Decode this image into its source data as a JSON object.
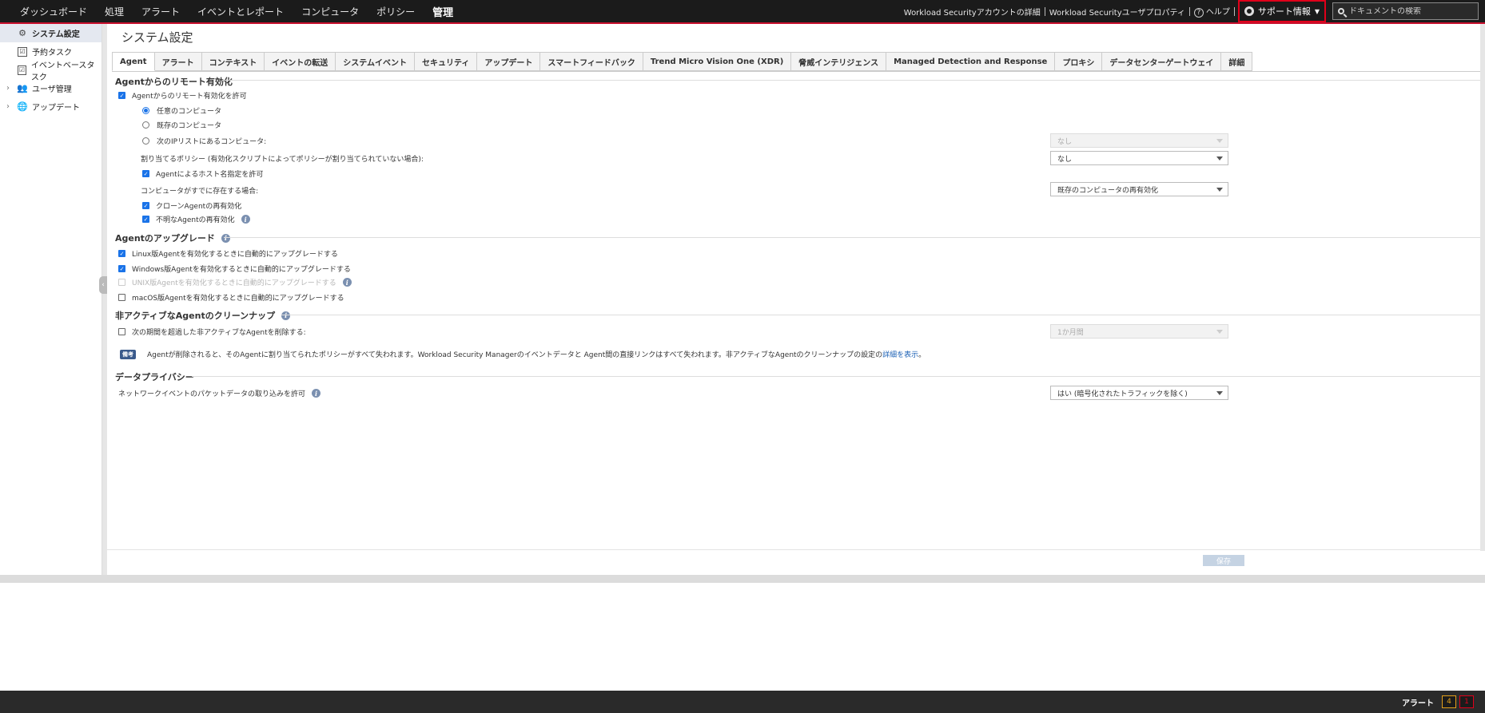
{
  "topnav": {
    "items": [
      "ダッシュボード",
      "処理",
      "アラート",
      "イベントとレポート",
      "コンピュータ",
      "ポリシー",
      "管理"
    ],
    "links": [
      "Workload Securityアカウントの詳細",
      "Workload Securityユーザプロパティ",
      "ヘルプ"
    ],
    "support_label": "サポート情報",
    "search_placeholder": "ドキュメントの検索"
  },
  "sidebar": {
    "items": [
      {
        "label": "システム設定"
      },
      {
        "label": "予約タスク"
      },
      {
        "label": "イベントベースタスク"
      },
      {
        "label": "ユーザ管理"
      },
      {
        "label": "アップデート"
      }
    ]
  },
  "main": {
    "title": "システム設定",
    "tabs": [
      "Agent",
      "アラート",
      "コンテキスト",
      "イベントの転送",
      "システムイベント",
      "セキュリティ",
      "アップデート",
      "スマートフィードバック",
      "Trend Micro Vision One (XDR)",
      "脅威インテリジェンス",
      "Managed Detection and Response",
      "プロキシ",
      "データセンターゲートウェイ",
      "詳細"
    ],
    "remote": {
      "heading": "Agentからのリモート有効化",
      "allow": "Agentからのリモート有効化を許可",
      "opt_any": "任意のコンピュータ",
      "opt_existing": "既存のコンピュータ",
      "opt_iplist": "次のIPリストにあるコンピュータ:",
      "iplist_value": "なし",
      "policy_label": "割り当てるポリシー (有効化スクリプトによってポリシーが割り当てられていない場合):",
      "policy_value": "なし",
      "hostname": "Agentによるホスト名指定を許可",
      "exists_label": "コンピュータがすでに存在する場合:",
      "exists_value": "既存のコンピュータの再有効化",
      "clone": "クローンAgentの再有効化",
      "unknown": "不明なAgentの再有効化"
    },
    "upgrade": {
      "heading": "Agentのアップグレード",
      "linux": "Linux版Agentを有効化するときに自動的にアップグレードする",
      "windows": "Windows版Agentを有効化するときに自動的にアップグレードする",
      "unix": "UNIX版Agentを有効化するときに自動的にアップグレードする",
      "macos": "macOS版Agentを有効化するときに自動的にアップグレードする"
    },
    "cleanup": {
      "heading": "非アクティブなAgentのクリーンナップ",
      "delete": "次の期間を超過した非アクティブなAgentを削除する:",
      "period_value": "1か月間",
      "note_badge": "備考",
      "note_text": "Agentが削除されると、そのAgentに割り当てられたポリシーがすべて失われます。Workload Security Managerのイベントデータと Agent間の直接リンクはすべて失われます。非アクティブなAgentのクリーンナップの設定の",
      "note_link": "詳細を表示",
      "note_end": "。"
    },
    "privacy": {
      "heading": "データプライバシー",
      "packet": "ネットワークイベントのパケットデータの取り込みを許可",
      "packet_value": "はい (暗号化されたトラフィックを除く)"
    },
    "save_label": "保存"
  },
  "statusbar": {
    "alert_label": "アラート",
    "warn_count": "4",
    "crit_count": "1"
  }
}
